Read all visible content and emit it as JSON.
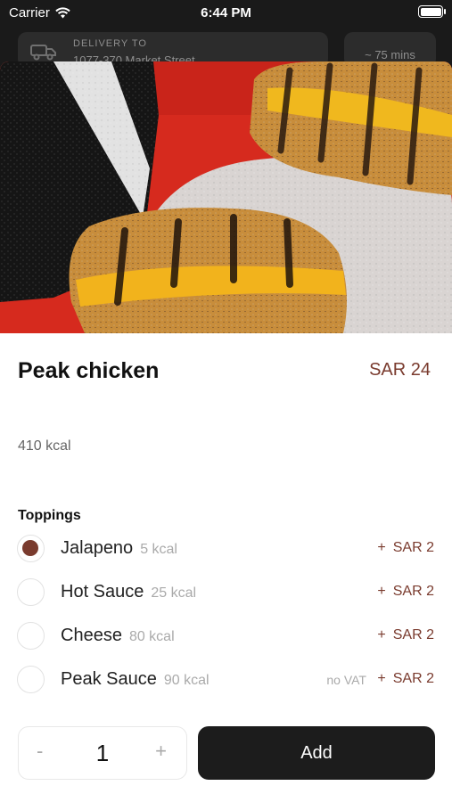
{
  "status_bar": {
    "carrier": "Carrier",
    "time": "6:44 PM",
    "battery_level": 1.0
  },
  "header_behind": {
    "delivery_label": "DELIVERY TO",
    "delivery_address": "1077-370 Market Street",
    "eta": "~ 75 mins"
  },
  "icons": {
    "wifi": "wifi-icon",
    "battery": "battery-icon",
    "truck": "truck-icon",
    "handle": "chevron-down-icon"
  },
  "product": {
    "name": "Peak chicken",
    "price": "SAR 24",
    "calories": "410 kcal"
  },
  "toppings": {
    "header": "Toppings",
    "items": [
      {
        "name": "Jalapeno",
        "kcal": "5 kcal",
        "plus": "+",
        "price": "SAR 2",
        "selected": true,
        "note": ""
      },
      {
        "name": "Hot Sauce",
        "kcal": "25 kcal",
        "plus": "+",
        "price": "SAR 2",
        "selected": false,
        "note": ""
      },
      {
        "name": "Cheese",
        "kcal": "80 kcal",
        "plus": "+",
        "price": "SAR 2",
        "selected": false,
        "note": ""
      },
      {
        "name": "Peak Sauce",
        "kcal": "90 kcal",
        "plus": "+",
        "price": "SAR 2",
        "selected": false,
        "note": "no VAT"
      }
    ]
  },
  "quantity": {
    "minus": "-",
    "value": "1",
    "plus": "+"
  },
  "add_button": {
    "label": "Add"
  },
  "colors": {
    "accent": "#7a3b2e",
    "primary_button": "#1c1c1c",
    "hero_background": "#d62a1e"
  }
}
